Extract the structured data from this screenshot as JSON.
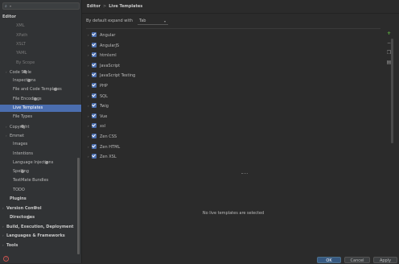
{
  "sidebar": {
    "search_placeholder": "",
    "items": [
      {
        "label": "Editor",
        "bold": true,
        "indent": 0,
        "arrow": ""
      },
      {
        "label": "XML",
        "indent": 3
      },
      {
        "label": "XPath",
        "indent": 3
      },
      {
        "label": "XSLT",
        "indent": 3
      },
      {
        "label": "YAML",
        "indent": 3
      },
      {
        "label": "By Scope",
        "indent": 3
      },
      {
        "label": "Code Style",
        "indent": 1,
        "arrow": ">",
        "gear": true
      },
      {
        "label": "Inspections",
        "indent": 2,
        "gear": true
      },
      {
        "label": "File and Code Templates",
        "indent": 2,
        "gear": true
      },
      {
        "label": "File Encodings",
        "indent": 2,
        "gear": true
      },
      {
        "label": "Live Templates",
        "indent": 2,
        "selected": true
      },
      {
        "label": "File Types",
        "indent": 2
      },
      {
        "label": "Copyright",
        "indent": 1,
        "arrow": ">",
        "gear": true
      },
      {
        "label": "Emmet",
        "indent": 1,
        "arrow": ">"
      },
      {
        "label": "Images",
        "indent": 2
      },
      {
        "label": "Intentions",
        "indent": 2
      },
      {
        "label": "Language Injections",
        "indent": 2,
        "gear": true
      },
      {
        "label": "Spelling",
        "indent": 2,
        "gear": true
      },
      {
        "label": "TextMate Bundles",
        "indent": 2
      },
      {
        "label": "TODO",
        "indent": 2
      },
      {
        "label": "Plugins",
        "bold": true,
        "indent": 1
      },
      {
        "label": "Version Control",
        "bold": true,
        "indent": 0,
        "arrow": ">",
        "gear": true
      },
      {
        "label": "Directories",
        "bold": true,
        "indent": 1,
        "gear": true
      },
      {
        "label": "Build, Execution, Deployment",
        "bold": true,
        "indent": 0,
        "arrow": ">"
      },
      {
        "label": "Languages & Frameworks",
        "bold": true,
        "indent": 0,
        "arrow": ">"
      },
      {
        "label": "Tools",
        "bold": true,
        "indent": 0,
        "arrow": ">"
      }
    ]
  },
  "header": {
    "crumb1": "Editor",
    "separator": ">",
    "crumb2": "Live Templates"
  },
  "expand": {
    "label": "By default expand with",
    "value": "Tab"
  },
  "templates": [
    "Angular",
    "AngularJS",
    "htmlxml",
    "JavaScript",
    "JavaScript Testing",
    "PHP",
    "SQL",
    "Twig",
    "Vue",
    "xsl",
    "Zen CSS",
    "Zen HTML",
    "Zen XSL"
  ],
  "empty_message": "No live templates are selected",
  "toolbar_icons": [
    "add-icon",
    "remove-icon",
    "copy-icon",
    "restore-icon"
  ],
  "buttons": {
    "ok": "OK",
    "cancel": "Cancel",
    "apply": "Apply"
  },
  "colors": {
    "selection": "#4b6eaf",
    "checkbox": "#4b6eaf",
    "add": "#62b543",
    "help": "#c75450"
  }
}
